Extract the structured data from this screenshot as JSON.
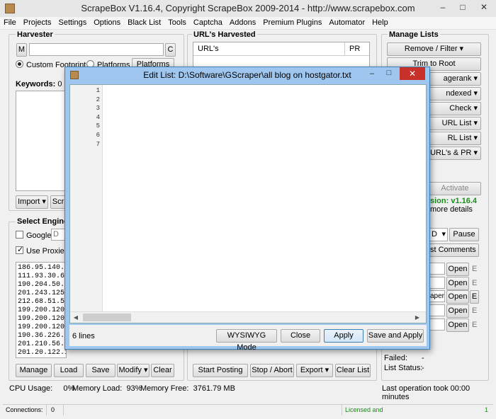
{
  "window": {
    "title": "ScrapeBox V1.16.4, Copyright ScrapeBox 2009-2014 - http://www.scrapebox.com",
    "minimize": "–",
    "maximize": "□",
    "close": "✕"
  },
  "menu": [
    "File",
    "Projects",
    "Settings",
    "Options",
    "Black List",
    "Tools",
    "Captcha",
    "Addons",
    "Premium Plugins",
    "Automator",
    "Help"
  ],
  "harvester": {
    "title": "Harvester",
    "m_label": "M",
    "c_label": "C",
    "radio_custom": "Custom Footprint",
    "radio_platforms": "Platforms",
    "platforms_btn": "Platforms",
    "keywords_label": "Keywords:",
    "keywords_count": "0",
    "import_btn": "Import",
    "scrape_btn": "Scr"
  },
  "urls": {
    "title": "URL's Harvested",
    "col_url": "URL's",
    "col_pr": "PR"
  },
  "manage_lists": {
    "title": "Manage Lists",
    "items": [
      "Remove / Filter",
      "Trim to Root",
      "agerank",
      "ndexed",
      "Check",
      "URL List",
      "RL List",
      "t URL's & PR"
    ]
  },
  "activate": {
    "label": "Activate",
    "version": "sion: v1.16.4",
    "more": "more details"
  },
  "engines": {
    "title": "Select Engines",
    "google_label": "Google",
    "google_sel": "D",
    "use_proxies": "Use Proxies"
  },
  "proxies": [
    "186.95.140.39:8",
    "111.93.30.66:31",
    "190.204.50.152",
    "201.243.125.88",
    "212.68.51.58:80",
    "199.200.120.14",
    "199.200.120.14",
    "199.200.120.14",
    "190.36.226.246",
    "201.210.56.151",
    "201.20.122.1"
  ],
  "proxy_buttons": {
    "manage": "Manage",
    "load": "Load",
    "save": "Save",
    "modify": "Modify",
    "clear": "Clear"
  },
  "right_mid": {
    "sel": "D",
    "pause": "Pause",
    "comments": "st Comments",
    "open": "Open",
    "e": "E",
    "scraper": "aper"
  },
  "posting": {
    "start": "Start Posting",
    "stop": "Stop / Abort",
    "export": "Export",
    "clear": "Clear List"
  },
  "status": {
    "failed_label": "Failed:",
    "failed_val": "-",
    "list_status_label": "List Status:",
    "list_status_val": "-"
  },
  "sysinfo": {
    "cpu_label": "CPU Usage:",
    "cpu_val": "0%",
    "mem_label": "Memory Load:",
    "mem_val": "93%",
    "free_label": "Memory Free:",
    "free_val": "3761.79 MB",
    "last_op": "Last operation took 00:00 minutes"
  },
  "statusbar": {
    "conn_label": "Connections:",
    "conn_val": "0",
    "licensed": "Licensed and",
    "right": "1"
  },
  "dialog": {
    "title": "Edit List: D:\\Software\\GScraper\\all blog on hostgator.txt",
    "line_numbers": [
      "1",
      "2",
      "3",
      "4",
      "5",
      "6",
      "7"
    ],
    "lines_count": "6 lines",
    "wysiwyg": "WYSIWYG Mode",
    "close": "Close",
    "apply": "Apply",
    "save_apply": "Save and Apply"
  },
  "colors": {
    "dialog_frame": "#9fc6ee",
    "close_red": "#c7312a",
    "licensed_green": "#1a8a1a",
    "version_green": "#1d8d1d"
  }
}
